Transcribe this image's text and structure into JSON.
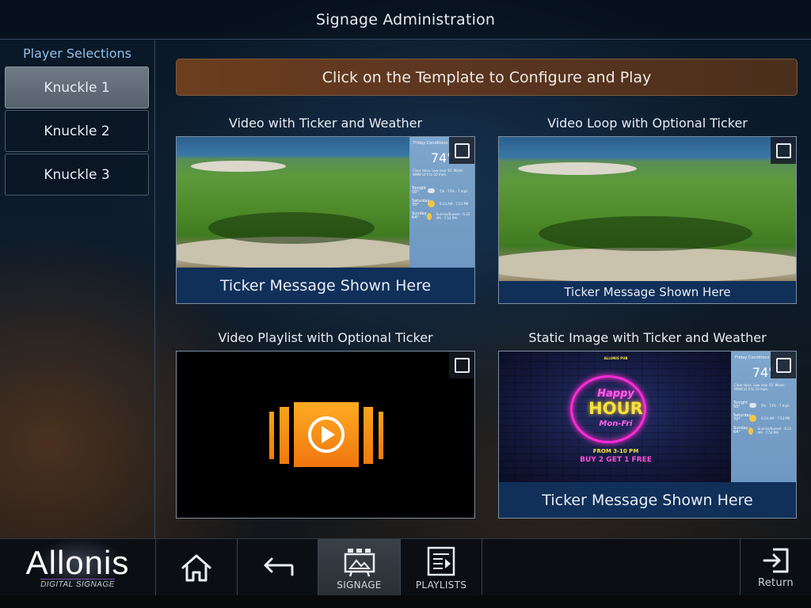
{
  "header": {
    "title": "Signage Administration"
  },
  "sidebar": {
    "title": "Player Selections",
    "items": [
      {
        "label": "Knuckle 1",
        "selected": true
      },
      {
        "label": "Knuckle 2",
        "selected": false
      },
      {
        "label": "Knuckle 3",
        "selected": false
      }
    ]
  },
  "main": {
    "banner": "Click on the Template to Configure and Play",
    "templates": [
      {
        "title": "Video with Ticker and Weather",
        "ticker": "Ticker Message Shown Here",
        "checked": false
      },
      {
        "title": "Video Loop with Optional Ticker",
        "ticker": "Ticker Message Shown Here",
        "checked": false
      },
      {
        "title": "Video Playlist with Optional Ticker",
        "checked": false
      },
      {
        "title": "Static Image with Ticker and Weather",
        "ticker": "Ticker Message Shown Here",
        "checked": false
      }
    ],
    "weather": {
      "title": "Friday Conditions",
      "temp": "74°",
      "desc": "Clear skies. Low near 50. Winds WNW at 5 to 10 mph.",
      "rows": [
        {
          "day": "Tonight",
          "temp": "50°",
          "detail": "5% · 73% · 7 mph"
        },
        {
          "day": "Saturday",
          "temp": "70°",
          "detail": "6:24 AM · 7:53 PM"
        },
        {
          "day": "Sunday",
          "temp": "64°",
          "detail": "Sunrise/Sunset · 6:22 AM · 7:54 PM"
        }
      ]
    },
    "poster": {
      "top_text": "ALLONIS PUB",
      "line1": "Happy",
      "line2": "HOUR",
      "line3": "Mon-Fri",
      "line4": "FROM 3-10 PM",
      "line5": "BUY 2 GET 1 FREE"
    }
  },
  "nav": {
    "logo": "Allonis",
    "logo_sub": "DIGITAL SIGNAGE",
    "signage_label": "SIGNAGE",
    "playlists_label": "PLAYLISTS",
    "return_label": "Return"
  },
  "colors": {
    "accent": "#8fc1ea",
    "banner": "#5a3520",
    "ticker": "#10305a",
    "neon_pink": "#ff2bd6",
    "neon_yellow": "#f6e23a",
    "playlist_orange": "#f58a14"
  },
  "icons": [
    "checkbox-icon",
    "home-icon",
    "back-arrow-icon",
    "signage-icon",
    "playlist-icon",
    "return-icon",
    "play-icon"
  ]
}
